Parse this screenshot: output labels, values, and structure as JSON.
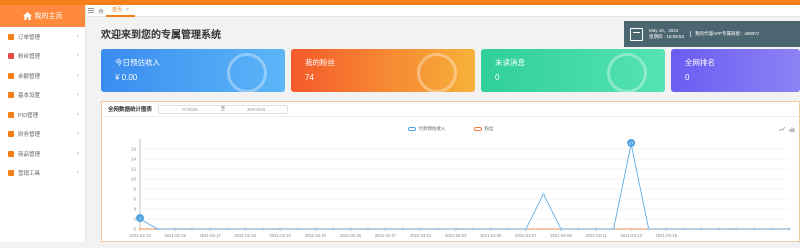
{
  "sidebar": {
    "brand": "我的主页",
    "items": [
      {
        "label": "订单管理",
        "color": "#f57f17"
      },
      {
        "label": "粉丝管理",
        "color": "#e64a4a"
      },
      {
        "label": "余额管理",
        "color": "#f57f17"
      },
      {
        "label": "基本设置",
        "color": "#f57f17"
      },
      {
        "label": "PID管理",
        "color": "#f57f17"
      },
      {
        "label": "财务管理",
        "color": "#f57f17"
      },
      {
        "label": "商品管理",
        "color": "#f57f17"
      },
      {
        "label": "营销工具",
        "color": "#f57f17"
      }
    ]
  },
  "tabs": {
    "active_label": "首页",
    "close_glyph": "×"
  },
  "welcome": "欢迎来到您的专属管理系统",
  "notice": {
    "date": "May 16，2024",
    "weekday_time": "星期四 · 16:08:53",
    "message": "我的代理APP专属链接：a9097z"
  },
  "cards": [
    {
      "title": "今日预估收入",
      "value": "¥ 0.00"
    },
    {
      "title": "我的粉丝",
      "value": "74"
    },
    {
      "title": "未读消息",
      "value": "0"
    },
    {
      "title": "全网排名",
      "value": "0"
    }
  ],
  "panel": {
    "title": "全网数据统计图表",
    "date_start": "Pri2028",
    "date_sep": "至",
    "date_end": "30R2026"
  },
  "chart_data": {
    "type": "line",
    "series": [
      {
        "name": "付款预估收入",
        "color": "#4fa3e0",
        "values": [
          2,
          0,
          0,
          0,
          0,
          0,
          0,
          0,
          0,
          0,
          0,
          0,
          0,
          0,
          0,
          0,
          0,
          0,
          0,
          0,
          0,
          0,
          0,
          7,
          0,
          0,
          0,
          0,
          17,
          0,
          0,
          0,
          0,
          0,
          0,
          0,
          0,
          0
        ]
      },
      {
        "name": "粉丝",
        "color": "#f07a3a",
        "values": [
          0,
          0,
          0,
          0,
          0,
          0,
          0,
          0,
          0,
          0,
          0,
          0,
          0,
          0,
          0,
          0,
          0,
          0,
          0,
          0,
          0,
          0,
          0,
          0,
          0,
          0,
          0,
          0,
          0,
          0,
          0,
          0,
          0,
          0,
          0,
          0,
          0,
          0
        ]
      }
    ],
    "point_labels": [
      {
        "series": 0,
        "index": 0,
        "text": "2"
      },
      {
        "series": 0,
        "index": 28,
        "text": "17"
      }
    ],
    "x_tick_labels": [
      "2021-02-13",
      "2021-02-15",
      "2021-02-17",
      "2021-02-19",
      "2021-02-21",
      "2021-02-23",
      "2021-02-25",
      "2021-02-27",
      "2021-03-01",
      "2021-03-03",
      "2021-03-05",
      "2021-03-07",
      "2021-03-09",
      "2021-03-11",
      "2021-03-13",
      "2021-03-15"
    ],
    "y_ticks": [
      0,
      2,
      4,
      6,
      8,
      10,
      12,
      14,
      16
    ],
    "ylim": [
      0,
      18
    ],
    "grid": true,
    "legend": "top-center"
  }
}
